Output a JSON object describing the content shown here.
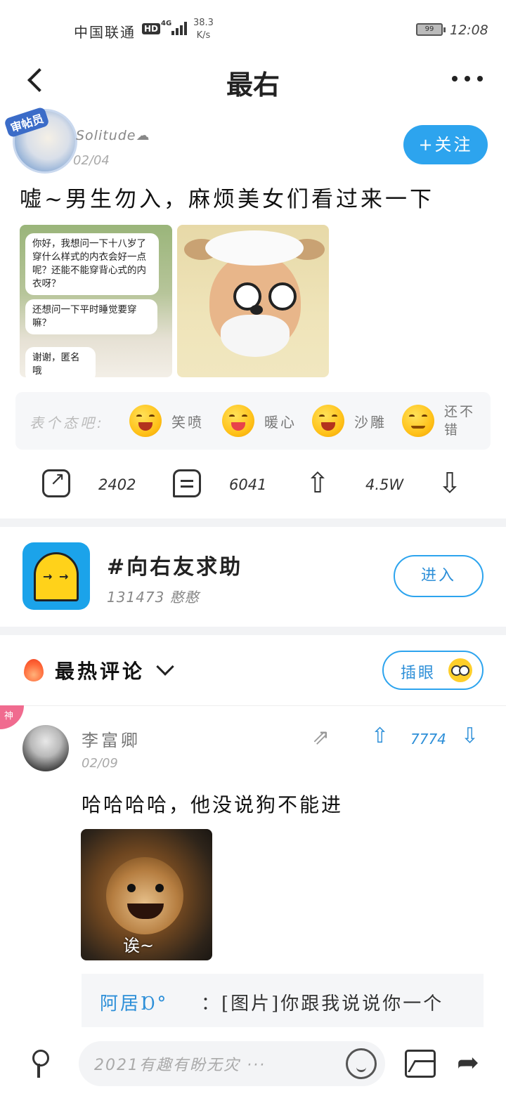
{
  "status_bar": {
    "carrier": "中国联通",
    "hd": "HD",
    "network": "4G",
    "speed_value": "38.3",
    "speed_unit": "K/s",
    "battery": "99",
    "time": "12:08"
  },
  "nav": {
    "title": "最右"
  },
  "post": {
    "author": "Solitude☁",
    "date": "02/04",
    "follow_label": "+关注",
    "text": "嘘~男生勿入，麻烦美女们看过来一下",
    "image1_bubbles": [
      "你好，我想问一下十八岁了穿什么样式的内衣会好一点呢？还能不能穿背心式的内衣呀？",
      "还想问一下平时睡觉要穿嘛？",
      "谢谢，匿名哦"
    ],
    "reaction_prompt": "表个态吧:",
    "reactions": [
      {
        "label": "笑喷",
        "icon": "laughing-tears-emoji"
      },
      {
        "label": "暖心",
        "icon": "heart-hug-emoji"
      },
      {
        "label": "沙雕",
        "icon": "silly-face-emoji"
      },
      {
        "label": "还不错",
        "icon": "smug-emoji"
      }
    ],
    "share_count": "2402",
    "comment_count": "6041",
    "upvote_count": "4.5W"
  },
  "topic": {
    "title": "#向右友求助",
    "subtitle": "131473 憨憨",
    "enter_label": "进入"
  },
  "comments": {
    "section_title": "最热评论",
    "insert_label": "插眼",
    "god_badge": "神",
    "top_comment": {
      "author": "李富卿",
      "date": "02/09",
      "likes": "7774",
      "text": "哈哈哈哈，他没说狗不能进",
      "image_caption": "诶~",
      "reply_author": "阿居Ɒ°",
      "reply_text": "：[图片]你跟我说说你一个"
    }
  },
  "bottom_bar": {
    "input_placeholder": "2021有趣有盼无灾 ···"
  },
  "colors": {
    "accent": "#2da4ee",
    "accent_text": "#2d8fd8",
    "god_badge": "#f06b8f"
  }
}
